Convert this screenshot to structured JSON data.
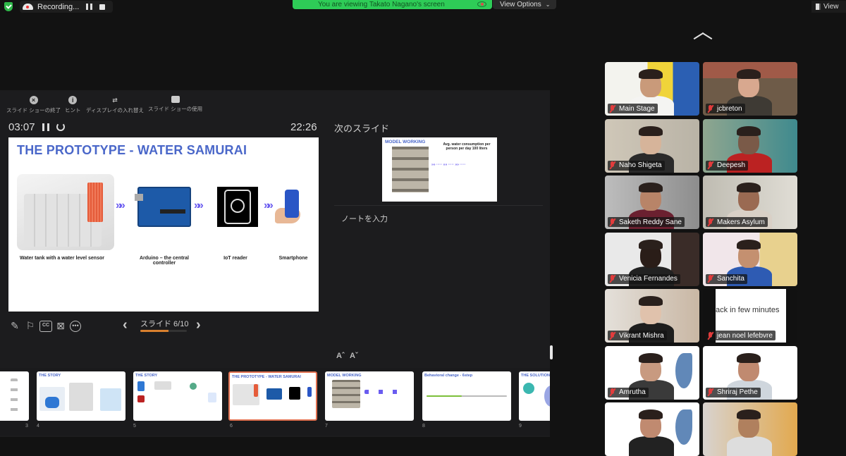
{
  "top_bar": {
    "recording_label": "Recording...",
    "share_banner": "You are viewing Takato Nagano's screen",
    "view_options_label": "View Options",
    "view_label": "View",
    "colors": {
      "banner": "#2ecc57",
      "recording_dot": "#e33333"
    }
  },
  "presenter": {
    "toolbar": [
      {
        "icon": "close-circle-icon",
        "glyph": "×",
        "label": "スライド ショーの終了"
      },
      {
        "icon": "info-icon",
        "glyph": "i",
        "label": "ヒント"
      },
      {
        "icon": "swap-arrows-icon",
        "glyph": "⇄",
        "label": "ディスプレイの入れ替え"
      },
      {
        "icon": "slideshow-icon",
        "glyph": "",
        "label": "スライド ショーの使用"
      }
    ],
    "elapsed_time": "03:07",
    "clock_time": "22:26",
    "current_slide": {
      "title": "THE PROTOTYPE - WATER SAMURAI",
      "arrow_glyph": "»»",
      "captions": [
        "Water tank with a water level sensor",
        "Arduino – the central controller",
        "IoT reader",
        "Smartphone"
      ]
    },
    "next_slide_label": "次のスライド",
    "next_slide": {
      "title": "MODEL WORKING",
      "heading": "Avg. water consumption per person per day 100 liters",
      "flow": "»» ····· »» ····· »» ·····"
    },
    "notes_placeholder": "ノートを入力",
    "font_increase": "Aˆ",
    "font_decrease": "Aˇ",
    "bottom_controls": {
      "pen_glyph": "✎",
      "laser_glyph": "⚐",
      "cc_label": "CC",
      "camera_glyph": "⊠",
      "more_glyph": "•••",
      "prev_glyph": "‹",
      "next_glyph": "›",
      "slide_counter": "スライド 6/10",
      "progress": 0.6,
      "colors": {
        "progress": "#d9802e"
      }
    },
    "filmstrip": [
      {
        "number": "3",
        "title": ""
      },
      {
        "number": "4",
        "title": "THE STORY"
      },
      {
        "number": "5",
        "title": "THE STORY"
      },
      {
        "number": "6",
        "title": "THE PROTOTYPE - WATER SAMURAI",
        "active": true
      },
      {
        "number": "7",
        "title": "MODEL WORKING"
      },
      {
        "number": "8",
        "title": "Behavioral change - 6step"
      },
      {
        "number": "9",
        "title": "THE SOLUTION"
      }
    ]
  },
  "gallery": {
    "participants": [
      {
        "name": "Main Stage",
        "muted": true
      },
      {
        "name": "jcbreton",
        "muted": true
      },
      {
        "name": "Naho Shigeta",
        "muted": true
      },
      {
        "name": "Deepesh",
        "muted": true
      },
      {
        "name": "Saketh Reddy Sane",
        "muted": true
      },
      {
        "name": "Makers Asylum",
        "muted": true
      },
      {
        "name": "Venicia Fernandes",
        "muted": true
      },
      {
        "name": "Sanchita",
        "muted": true
      },
      {
        "name": "Vikrant Mishra",
        "muted": true
      },
      {
        "name": "jean noel lefebvre",
        "muted": true,
        "screen_text": "ack in few minutes"
      },
      {
        "name": "Amrutha",
        "muted": true
      },
      {
        "name": "Shriraj Pethe",
        "muted": true
      },
      {
        "name": "",
        "muted": false
      },
      {
        "name": "",
        "muted": false
      }
    ]
  }
}
